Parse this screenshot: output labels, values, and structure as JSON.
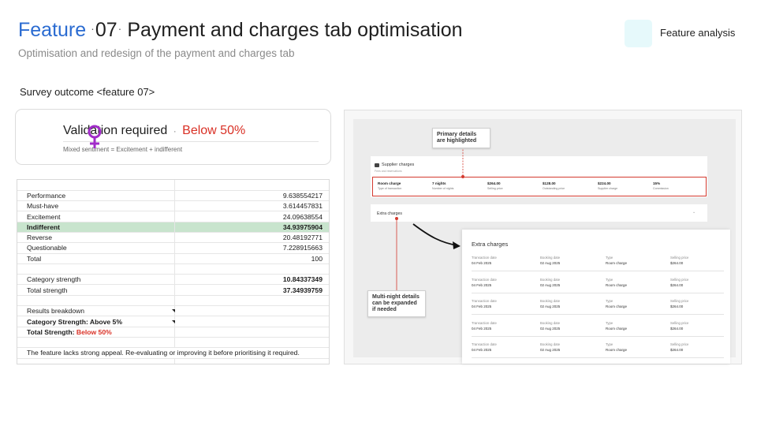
{
  "header": {
    "feature_word": "Feature",
    "dot1": "·",
    "number": "07",
    "dot2": "·",
    "title": "Payment and charges tab optimisation",
    "subtitle": "Optimisation and redesign of the payment and charges tab",
    "badge_label": "Feature analysis"
  },
  "colors": {
    "brand_blue": "#2a6bd1",
    "negative_red": "#d93025",
    "highlight_green": "#c8e4cd",
    "callout_red": "#d43a2f",
    "badge_bg": "#e6f9fb"
  },
  "survey_label": "Survey outcome <feature 07>",
  "validation": {
    "text": "Validation required",
    "sep": "·",
    "result": "Below 50%",
    "subtext": "Mixed sentiment = Excitement + indifferent",
    "icon": "venus-icon"
  },
  "sheet": {
    "rows": [
      {
        "label": "Performance",
        "value": "9.638554217"
      },
      {
        "label": "Must-have",
        "value": "3.614457831"
      },
      {
        "label": "Excitement",
        "value": "24.09638554"
      },
      {
        "label": "Indifferent",
        "value": "34.93975904"
      },
      {
        "label": "Reverse",
        "value": "20.48192771"
      },
      {
        "label": "Questionable",
        "value": "7.228915663"
      },
      {
        "label": "Total",
        "value": "100"
      }
    ],
    "strength": [
      {
        "label": "Category strength",
        "value": "10.84337349"
      },
      {
        "label": "Total strength",
        "value": "37.34939759"
      }
    ],
    "breakdown_title": "Results breakdown",
    "category_strength_label": "Category Strength: Above 5%",
    "total_strength_label": "Total Strength:",
    "total_strength_value": "Below 50%",
    "conclusion": "The feature lacks strong appeal. Re-evaluating or improving it before prioritising it required."
  },
  "screenshot": {
    "supplier_title": "Supplier charges",
    "supplier_sub": "Fees and reservations",
    "primary_cells": [
      {
        "value": "Room charge",
        "label": "Type of transaction"
      },
      {
        "value": "7 nights",
        "label": "Number of nights"
      },
      {
        "value": "$264.00",
        "label": "Selling price"
      },
      {
        "value": "$128.00",
        "label": "Outstanding price"
      },
      {
        "value": "$224.00",
        "label": "Supplier charge"
      },
      {
        "value": "15%",
        "label": "Commission"
      }
    ],
    "extra_charges_bar": "Extra charges",
    "callout_primary": "Primary details are highlighted",
    "callout_multi": "Multi-night details can be expanded if needed",
    "panel_title": "Extra charges",
    "panel_headers": [
      "Transaction date",
      "Booking date",
      "Type",
      "Selling price"
    ],
    "panel_rows": [
      [
        "04 Feb 2025",
        "02 Aug 2025",
        "Room charge",
        "$264.00"
      ],
      [
        "04 Feb 2025",
        "02 Aug 2025",
        "Room charge",
        "$264.00"
      ],
      [
        "04 Feb 2025",
        "02 Aug 2025",
        "Room charge",
        "$264.00"
      ],
      [
        "04 Feb 2025",
        "02 Aug 2025",
        "Room charge",
        "$264.00"
      ],
      [
        "04 Feb 2025",
        "02 Aug 2025",
        "Room charge",
        "$264.00"
      ]
    ]
  }
}
